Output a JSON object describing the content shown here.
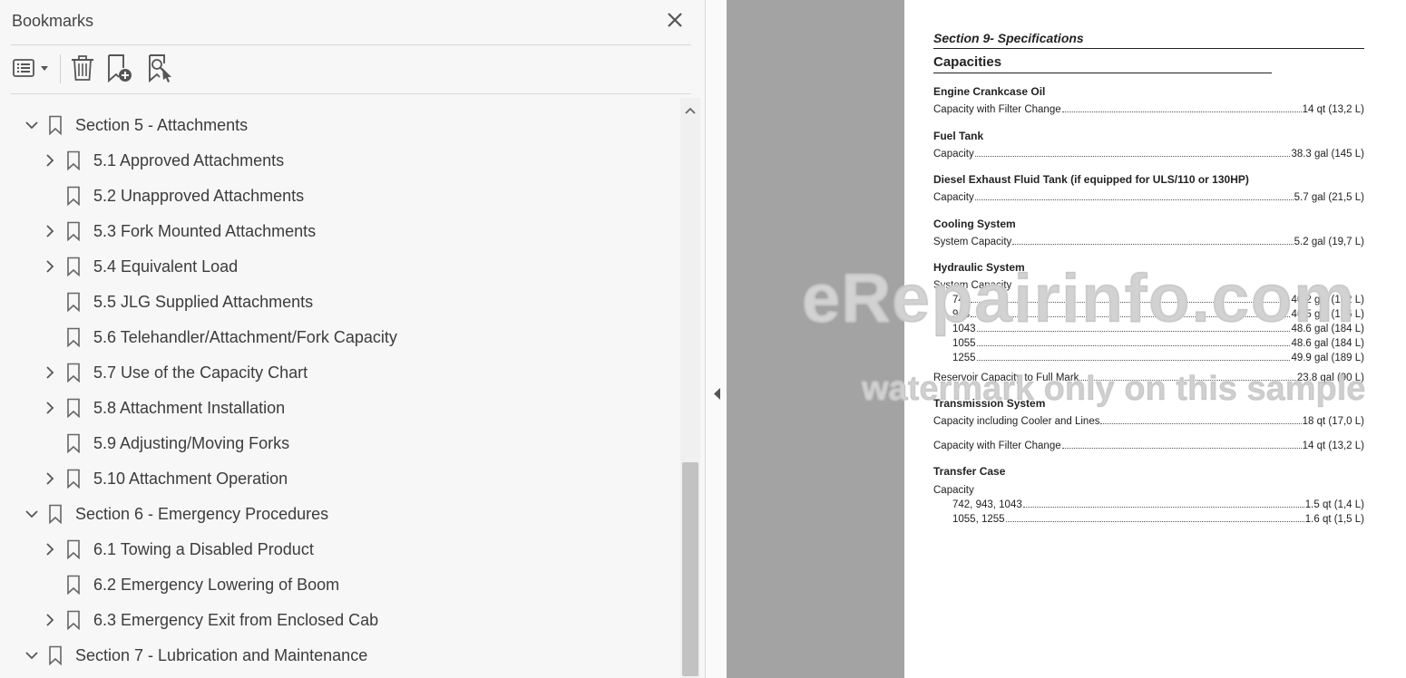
{
  "panel": {
    "title": "Bookmarks",
    "toolbar_icons": [
      "options-menu-icon",
      "trash-icon",
      "add-bookmark-icon",
      "bookmark-search-icon"
    ]
  },
  "bookmarks": [
    {
      "label": "Section 5 - Attachments",
      "level": 0,
      "chevron": "expanded"
    },
    {
      "label": "5.1 Approved Attachments",
      "level": 1,
      "chevron": "collapsed"
    },
    {
      "label": "5.2 Unapproved Attachments",
      "level": 1,
      "chevron": "none"
    },
    {
      "label": "5.3 Fork Mounted Attachments",
      "level": 1,
      "chevron": "collapsed"
    },
    {
      "label": "5.4 Equivalent Load",
      "level": 1,
      "chevron": "collapsed"
    },
    {
      "label": "5.5 JLG Supplied Attachments",
      "level": 1,
      "chevron": "none"
    },
    {
      "label": "5.6 Telehandler/Attachment/Fork Capacity",
      "level": 1,
      "chevron": "none"
    },
    {
      "label": "5.7 Use of the Capacity Chart",
      "level": 1,
      "chevron": "collapsed"
    },
    {
      "label": "5.8 Attachment Installation",
      "level": 1,
      "chevron": "collapsed"
    },
    {
      "label": "5.9 Adjusting/Moving Forks",
      "level": 1,
      "chevron": "none"
    },
    {
      "label": "5.10 Attachment Operation",
      "level": 1,
      "chevron": "collapsed"
    },
    {
      "label": "Section 6 - Emergency Procedures",
      "level": 0,
      "chevron": "expanded"
    },
    {
      "label": "6.1 Towing a Disabled Product",
      "level": 1,
      "chevron": "collapsed"
    },
    {
      "label": "6.2 Emergency Lowering of Boom",
      "level": 1,
      "chevron": "none"
    },
    {
      "label": "6.3 Emergency Exit from Enclosed Cab",
      "level": 1,
      "chevron": "collapsed"
    },
    {
      "label": "Section 7 - Lubrication and Maintenance",
      "level": 0,
      "chevron": "expanded"
    }
  ],
  "document": {
    "section_title": "Section 9- Specifications",
    "heading": "Capacities",
    "engine": {
      "title": "Engine Crankcase Oil",
      "label": "Capacity with Filter Change",
      "value": "14 qt (13,2 L)"
    },
    "fuel": {
      "title": "Fuel Tank",
      "label": "Capacity",
      "value": "38.3 gal (145 L)"
    },
    "def": {
      "title": "Diesel Exhaust Fluid Tank (if equipped for ULS/110 or 130HP)",
      "label": "Capacity",
      "value": "5.7 gal (21,5 L)"
    },
    "cooling": {
      "title": "Cooling System",
      "label": "System Capacity",
      "value": "5.2 gal (19,7 L)"
    },
    "hydraulic": {
      "title": "Hydraulic System",
      "sub": "System Capacity",
      "rows": [
        {
          "model": "742",
          "value": "40.2 gal (152 L)"
        },
        {
          "model": "943",
          "value": "46.5 gal (176 L)"
        },
        {
          "model": "1043",
          "value": "48.6 gal (184 L)"
        },
        {
          "model": "1055",
          "value": "48.6 gal (184 L)"
        },
        {
          "model": "1255",
          "value": "49.9 gal (189 L)"
        }
      ],
      "reservoir_label": "Reservoir Capacity to Full Mark",
      "reservoir_value": "23.8 gal (90 L)"
    },
    "transmission": {
      "title": "Transmission System",
      "label1": "Capacity including Cooler and Lines",
      "value1": "18 qt (17,0 L)",
      "label2": "Capacity with Filter Change",
      "value2": "14 qt (13,2 L)"
    },
    "transfer": {
      "title": "Transfer Case",
      "sub": "Capacity",
      "rows": [
        {
          "model": "742, 943, 1043",
          "value": "1.5 qt (1,4 L)"
        },
        {
          "model": "1055, 1255",
          "value": "1.6 qt (1,5 L)"
        }
      ]
    },
    "watermark": {
      "main": "eRepairinfo.com",
      "sub": "watermark only on this sample"
    }
  }
}
